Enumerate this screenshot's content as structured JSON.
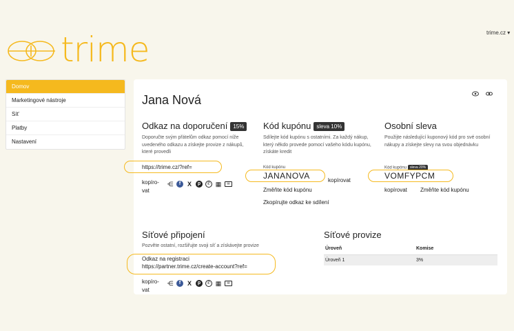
{
  "brand": {
    "name": "trime"
  },
  "topnav": {
    "site": "trime.cz ▾"
  },
  "sidebar": {
    "items": [
      {
        "label": "Domov"
      },
      {
        "label": "Marketingové nástroje"
      },
      {
        "label": "Síť"
      },
      {
        "label": "Platby"
      },
      {
        "label": "Nastavení"
      }
    ]
  },
  "profile": {
    "name": "Jana Nová"
  },
  "referral": {
    "title": "Odkaz na doporučení",
    "badge": "15%",
    "desc": "Doporučte svým přátelům odkaz pomocí níže uvedeného odkazu a získejte provize z nákupů, které provedli",
    "link": "https://trime.cz/?ref=",
    "copy": "kopíro-\nvat"
  },
  "coupon": {
    "title": "Kód kupónu",
    "badge": "sleva 10%",
    "desc": "Sdílejte kód kupónu s ostatními. Za každý nákup, který někdo provede pomocí vašeho kódu kupónu, získáte kredit",
    "label": "Kód kupónu",
    "code": "JANANOVA",
    "copy": "kopírovat",
    "change": "Změňte kód kupónu",
    "copy_link": "Zkopírujte odkaz ke sdílení"
  },
  "personal": {
    "title": "Osobní sleva",
    "desc": "Použijte následující kuponový kód pro své osobní nákupy a získejte slevy na svou objednávku",
    "label": "Kód kupónu",
    "badge": "sleva 20%",
    "code": "VOMFYPCM",
    "copy": "kopírovat",
    "change": "Změňte kód kupónu"
  },
  "network": {
    "title": "Síťové připojení",
    "desc": "Pozvěte ostatní, rozšiřujte svoji síť a získávejte provize",
    "label": "Odkaz na registraci",
    "link": "https://partner.trime.cz/create-account?ref=",
    "copy": "kopíro-\nvat"
  },
  "commissions": {
    "title": "Síťové provize",
    "headers": [
      "Úroveň",
      "Komise"
    ],
    "rows": [
      [
        "Úroveň 1",
        "3%"
      ]
    ]
  },
  "icons": {
    "view": "eye-icon",
    "link": "link-icon"
  },
  "colors": {
    "accent": "#f5b91e",
    "background": "#f8f6ec"
  }
}
